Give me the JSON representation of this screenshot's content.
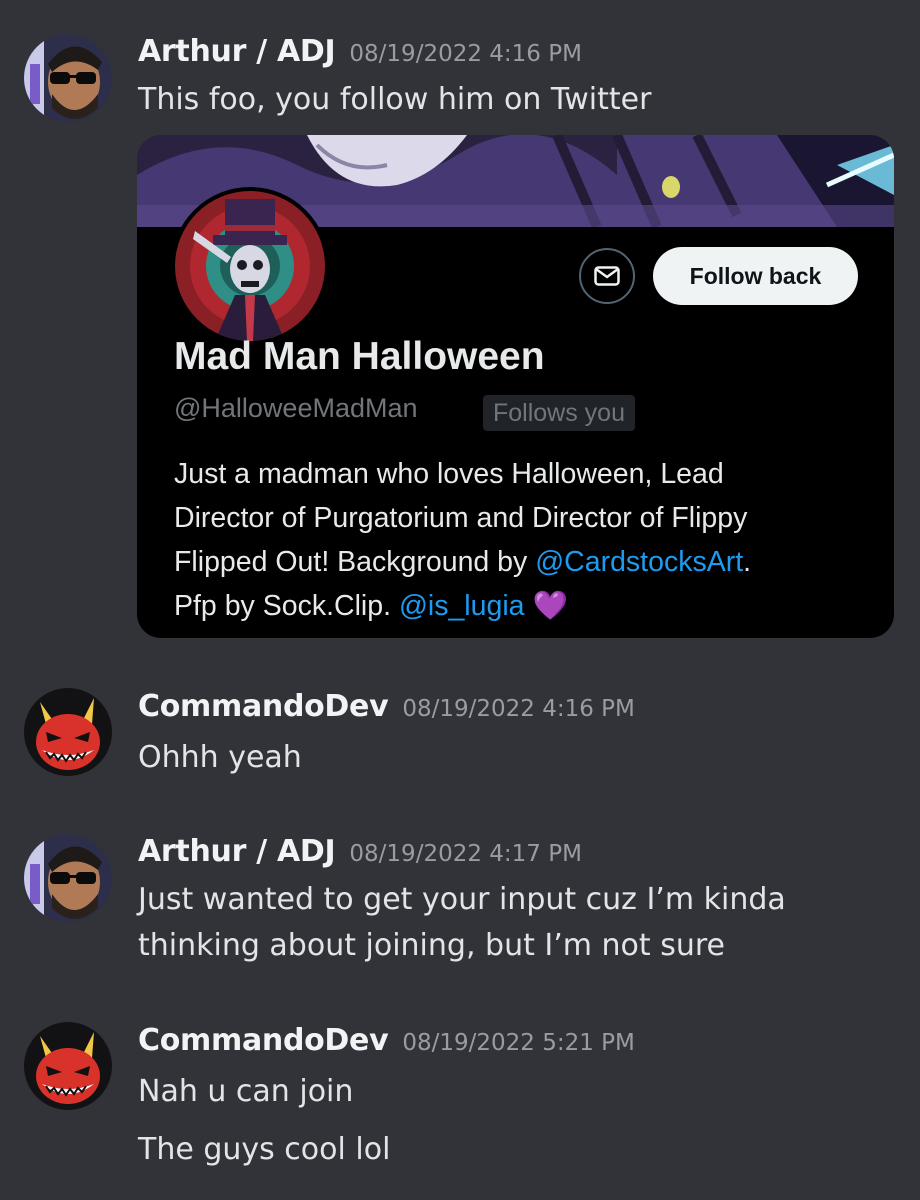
{
  "messages": [
    {
      "author": "Arthur / ADJ",
      "timestamp": "08/19/2022 4:16 PM",
      "lines": [
        "This foo, you follow him on Twitter"
      ],
      "avatar_icon": "sunglasses-man-avatar"
    },
    {
      "author": "CommandoDev",
      "timestamp": "08/19/2022 4:16 PM",
      "lines": [
        "Ohhh yeah"
      ],
      "avatar_icon": "red-devil-avatar"
    },
    {
      "author": "Arthur / ADJ",
      "timestamp": "08/19/2022 4:17 PM",
      "lines": [
        "Just wanted to get your input cuz I’m kinda",
        "thinking about joining, but I’m not sure"
      ],
      "avatar_icon": "sunglasses-man-avatar"
    },
    {
      "author": "CommandoDev",
      "timestamp": "08/19/2022 5:21 PM",
      "lines": [
        "Nah u can join",
        "The guys cool lol"
      ],
      "avatar_icon": "red-devil-avatar"
    }
  ],
  "twitter_card": {
    "display_name": "Mad Man Halloween",
    "handle": "@HalloweeMadMan",
    "follows_you": "Follows you",
    "follow_button": "Follow back",
    "dm_icon": "envelope-icon",
    "bio": {
      "line1": "Just a madman who loves Halloween, Lead",
      "line2": "Director of Purgatorium and Director of Flippy",
      "line3_text": "Flipped Out! Background by ",
      "line3_link": "@CardstocksArt",
      "line3_end": ".",
      "line4_text": "Pfp by Sock.Clip. ",
      "line4_link": "@is_lugia",
      "line4_emoji": "💜"
    }
  },
  "colors": {
    "background": "#323338",
    "link": "#1d9bf0",
    "card": "#000000"
  }
}
